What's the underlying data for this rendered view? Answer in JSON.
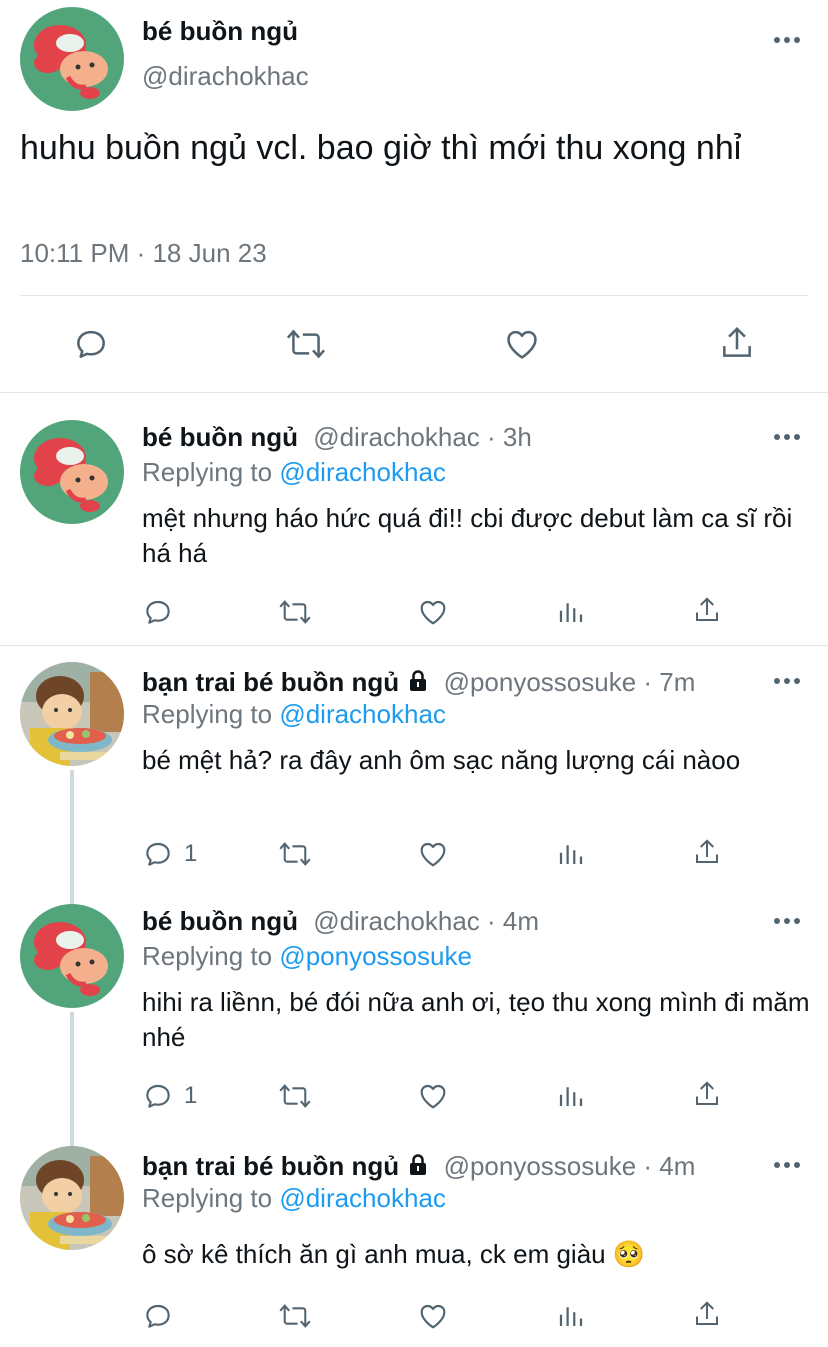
{
  "main_tweet": {
    "author_name": "bé buồn ngủ",
    "handle": "@dirachokhac",
    "text": "huhu buồn ngủ vcl. bao giờ thì mới thu xong nhỉ",
    "timestamp": "10:11 PM · 18 Jun 23"
  },
  "replies": [
    {
      "author_name": "bé buồn ngủ",
      "meta": "@dirachokhac · 3h",
      "replying_prefix": "Replying to",
      "replying_to": "@dirachokhac",
      "text": "mệt nhưng háo hức quá đi!! cbi được debut làm ca sĩ rồi há há",
      "reply_count": ""
    },
    {
      "author_name": "bạn trai bé buồn ngủ",
      "meta": "@ponyossosuke · 7m",
      "replying_prefix": "Replying to",
      "replying_to": "@dirachokhac",
      "text": "bé mệt hả? ra đây anh ôm sạc năng lượng cái nàoo",
      "reply_count": "1"
    },
    {
      "author_name": "bé buồn ngủ",
      "meta": "@dirachokhac · 4m",
      "replying_prefix": "Replying to",
      "replying_to": "@ponyossosuke",
      "text": "hihi ra liềnn, bé đói nữa anh ơi, tẹo thu xong mình đi măm nhé",
      "reply_count": "1"
    },
    {
      "author_name": "bạn trai bé buồn ngủ",
      "meta": "@ponyossosuke · 4m",
      "replying_prefix": "Replying to",
      "replying_to": "@dirachokhac",
      "text": "ô sờ kê thích ăn gì anh mua, ck em giàu 🥺",
      "reply_count": ""
    }
  ],
  "colors": {
    "accent_blue": "#1d9bf0",
    "secondary_grey": "#6e767d",
    "icon_grey": "#536471",
    "divider": "#e3e6e8"
  },
  "icons": [
    "more-icon",
    "reply-icon",
    "retweet-icon",
    "like-icon",
    "views-icon",
    "share-icon",
    "lock-icon"
  ]
}
